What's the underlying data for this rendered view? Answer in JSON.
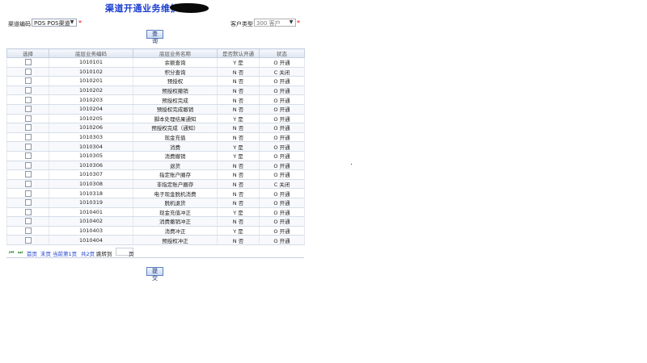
{
  "header": {
    "title": "渠道开通业务维护"
  },
  "filters": {
    "channel_label": "渠道编码",
    "channel_value": "POS POS渠道",
    "customer_type_label": "客户类型",
    "customer_type_value": "300 客户",
    "required_mark": "*"
  },
  "buttons": {
    "query": "查询",
    "submit": "提交"
  },
  "table": {
    "headers": [
      "选择",
      "底层业务编码",
      "底层业务名称",
      "是否默认开通",
      "状态"
    ],
    "rows": [
      {
        "code": "1010101",
        "name": "余额查询",
        "default": "Y 是",
        "status": "O 开通"
      },
      {
        "code": "1010102",
        "name": "积分查询",
        "default": "N 否",
        "status": "C 关闭"
      },
      {
        "code": "1010201",
        "name": "预授权",
        "default": "N 否",
        "status": "O 开通"
      },
      {
        "code": "1010202",
        "name": "预授权撤销",
        "default": "N 否",
        "status": "O 开通"
      },
      {
        "code": "1010203",
        "name": "预授权完成",
        "default": "N 否",
        "status": "O 开通"
      },
      {
        "code": "1010204",
        "name": "预授权完成撤销",
        "default": "N 否",
        "status": "O 开通"
      },
      {
        "code": "1010205",
        "name": "脚本处理结果通知",
        "default": "Y 是",
        "status": "O 开通"
      },
      {
        "code": "1010206",
        "name": "预授权完成（通知）",
        "default": "N 否",
        "status": "O 开通"
      },
      {
        "code": "1010303",
        "name": "现金充值",
        "default": "N 否",
        "status": "O 开通"
      },
      {
        "code": "1010304",
        "name": "消费",
        "default": "Y 是",
        "status": "O 开通"
      },
      {
        "code": "1010305",
        "name": "消费撤销",
        "default": "Y 是",
        "status": "O 开通"
      },
      {
        "code": "1010306",
        "name": "退货",
        "default": "N 否",
        "status": "O 开通"
      },
      {
        "code": "1010307",
        "name": "指定账户圈存",
        "default": "N 否",
        "status": "O 开通"
      },
      {
        "code": "1010308",
        "name": "非指定账户圈存",
        "default": "N 否",
        "status": "C 关闭"
      },
      {
        "code": "1010318",
        "name": "电子现金脱机消费",
        "default": "N 否",
        "status": "O 开通"
      },
      {
        "code": "1010319",
        "name": "脱机退货",
        "default": "N 否",
        "status": "O 开通"
      },
      {
        "code": "1010401",
        "name": "现金充值冲正",
        "default": "Y 是",
        "status": "O 开通"
      },
      {
        "code": "1010402",
        "name": "消费撤销冲正",
        "default": "N 否",
        "status": "O 开通"
      },
      {
        "code": "1010403",
        "name": "消费冲正",
        "default": "Y 是",
        "status": "O 开通"
      },
      {
        "code": "1010404",
        "name": "预授权冲正",
        "default": "N 否",
        "status": "O 开通"
      }
    ]
  },
  "pager": {
    "first": "首页",
    "last": "末页",
    "current": "当前第1页",
    "total": "共2页",
    "goto": "跳转到",
    "page_unit": "页"
  },
  "icons": {
    "first_page": "first-page-icon",
    "last_page": "last-page-icon"
  },
  "colors": {
    "title": "#1a3ed0",
    "link": "#1a3ed0",
    "required": "#e00000"
  }
}
